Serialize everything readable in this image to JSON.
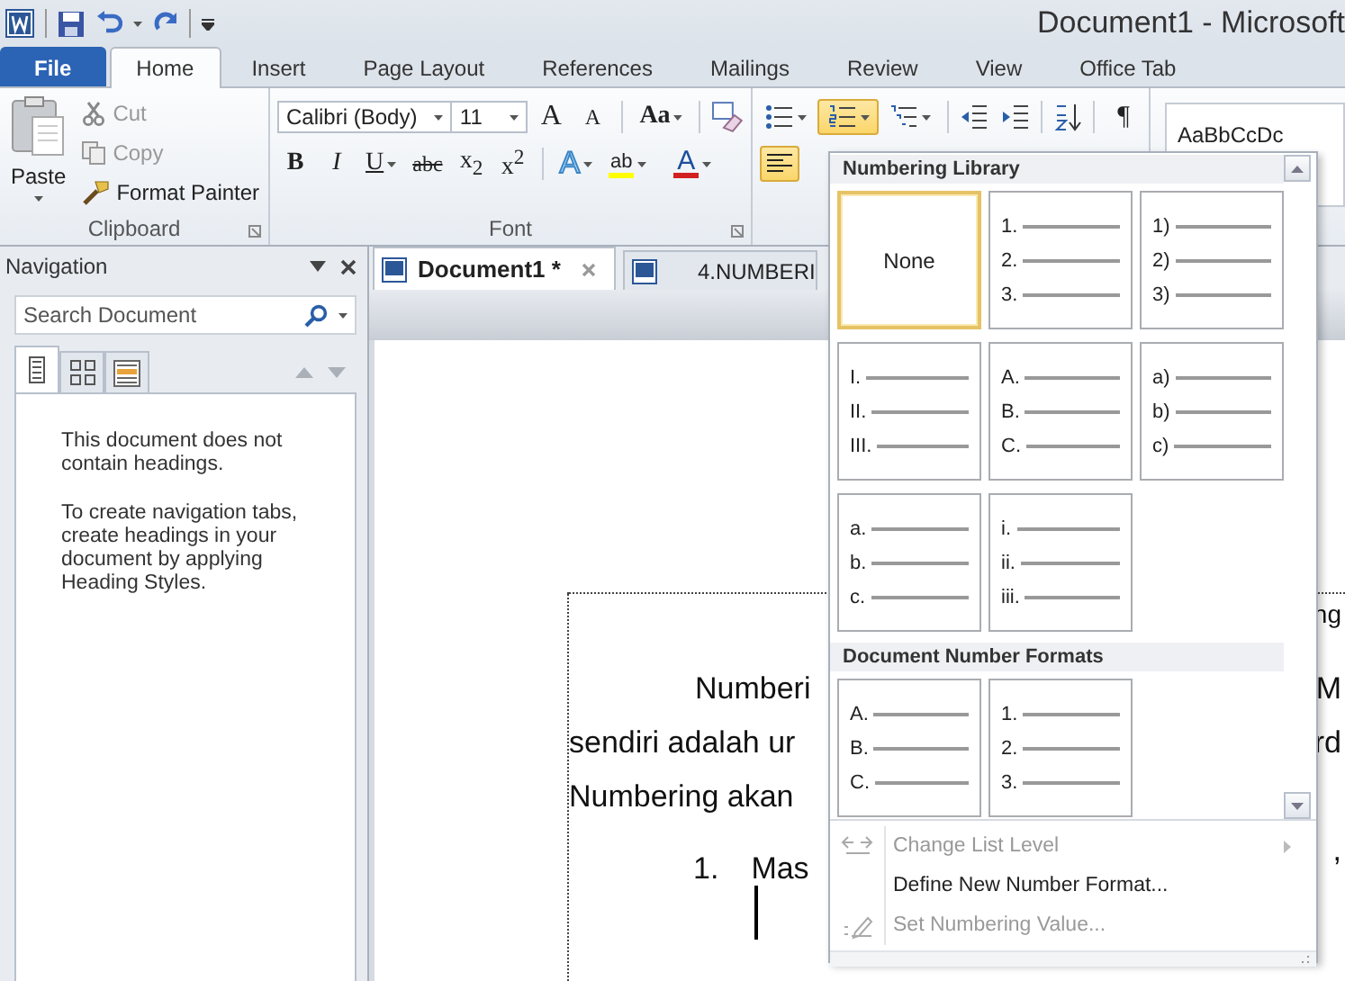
{
  "window": {
    "title": "Document1  -  Microsoft"
  },
  "ribbon_tabs": [
    {
      "label": "File",
      "kind": "file",
      "selected": false
    },
    {
      "label": "Home",
      "kind": "tab",
      "selected": true
    },
    {
      "label": "Insert",
      "kind": "tab",
      "selected": false
    },
    {
      "label": "Page Layout",
      "kind": "tab",
      "selected": false
    },
    {
      "label": "References",
      "kind": "tab",
      "selected": false
    },
    {
      "label": "Mailings",
      "kind": "tab",
      "selected": false
    },
    {
      "label": "Review",
      "kind": "tab",
      "selected": false
    },
    {
      "label": "View",
      "kind": "tab",
      "selected": false
    },
    {
      "label": "Office Tab",
      "kind": "tab",
      "selected": false
    }
  ],
  "clipboard": {
    "paste": "Paste",
    "group_label": "Clipboard",
    "items": [
      {
        "label": "Cut",
        "kind": "cut",
        "disabled": true
      },
      {
        "label": "Copy",
        "kind": "copy",
        "disabled": true
      },
      {
        "label": "Format Painter",
        "kind": "painter",
        "disabled": false
      }
    ]
  },
  "font": {
    "family": "Calibri (Body)",
    "size": "11",
    "grow": "A",
    "shrink": "A",
    "change_case": "Aa",
    "group_label": "Font",
    "format_buttons": [
      {
        "kind": "bold",
        "label": "B"
      },
      {
        "kind": "italic",
        "label": "I"
      },
      {
        "kind": "underline",
        "label": "U"
      },
      {
        "kind": "strike",
        "label": "abc"
      },
      {
        "kind": "sub",
        "label": "x$_{2}$"
      },
      {
        "kind": "sup",
        "label": "x$^{2}$"
      }
    ],
    "effects": "A",
    "highlight": "ab",
    "font_color": "A"
  },
  "paragraph": {
    "numbering_open": true,
    "align_left_selected": true,
    "pilcrow": "¶"
  },
  "styles": {
    "preview": "AaBbCcDc"
  },
  "navigation": {
    "title": "Navigation",
    "search_placeholder": "Search Document",
    "tabs": [
      {
        "kind": "headings",
        "selected": true
      },
      {
        "kind": "pages",
        "selected": false
      },
      {
        "kind": "results",
        "selected": false
      }
    ],
    "message": [
      "This document does not contain headings.",
      "To create navigation tabs, create headings in your document by applying Heading Styles."
    ]
  },
  "doc_tabs": [
    {
      "label": "Document1 *",
      "selected": true
    },
    {
      "label": "4.NUMBERI",
      "selected": false
    }
  ],
  "document": {
    "cursor": true,
    "lines": [
      {
        "kind": "plain",
        "right": "ng"
      },
      {
        "kind": "indent",
        "left": "Numberi",
        "right": "M"
      },
      {
        "kind": "plain",
        "left": "sendiri adalah ur",
        "right": "rd"
      },
      {
        "kind": "plain",
        "left": "Numbering akan"
      },
      {
        "kind": "list",
        "number": "1.",
        "left": "Mas",
        "right": ","
      }
    ]
  },
  "numbering_menu": {
    "sections": [
      {
        "title": "Numbering Library",
        "items": [
          {
            "kind": "none",
            "label": "None",
            "selected": true
          },
          {
            "kind": "list",
            "markers": [
              "1.",
              "2.",
              "3."
            ],
            "selected": false
          },
          {
            "kind": "list",
            "markers": [
              "1)",
              "2)",
              "3)"
            ],
            "selected": false
          },
          {
            "kind": "list",
            "markers": [
              "I.",
              "II.",
              "III."
            ],
            "selected": false
          },
          {
            "kind": "list",
            "markers": [
              "A.",
              "B.",
              "C."
            ],
            "selected": false
          },
          {
            "kind": "list",
            "markers": [
              "a)",
              "b)",
              "c)"
            ],
            "selected": false
          },
          {
            "kind": "list",
            "markers": [
              "a.",
              "b.",
              "c."
            ],
            "selected": false
          },
          {
            "kind": "list",
            "markers": [
              "i.",
              "ii.",
              "iii."
            ],
            "selected": false
          }
        ]
      },
      {
        "title": "Document Number Formats",
        "items": [
          {
            "kind": "list",
            "markers": [
              "A.",
              "B.",
              "C."
            ],
            "selected": false
          },
          {
            "kind": "list",
            "markers": [
              "1.",
              "2.",
              "3."
            ],
            "selected": false
          }
        ]
      }
    ],
    "commands": [
      {
        "label": "Change List Level",
        "kind": "level",
        "disabled": true,
        "submenu": true
      },
      {
        "label": "Define New Number Format...",
        "kind": "define",
        "disabled": false
      },
      {
        "label": "Set Numbering Value...",
        "kind": "value",
        "disabled": true
      }
    ]
  }
}
